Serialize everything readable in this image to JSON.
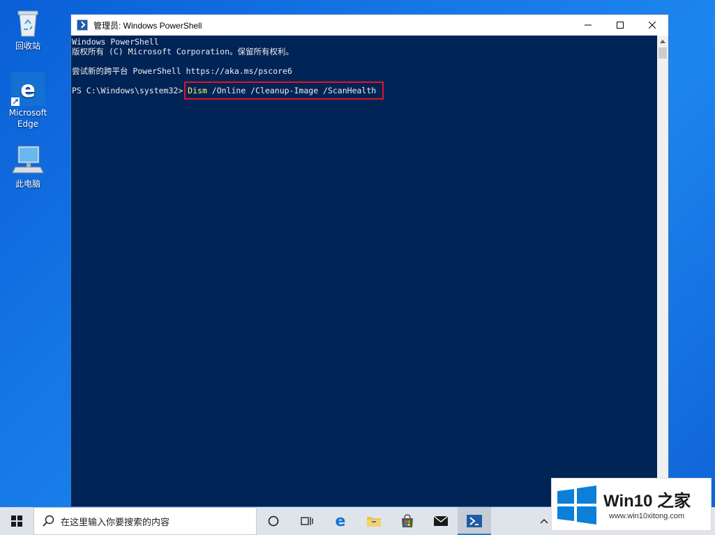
{
  "desktop": {
    "icons": [
      {
        "label": "回收站"
      },
      {
        "label": "Microsoft Edge"
      },
      {
        "label": "此电脑"
      }
    ]
  },
  "window": {
    "title": "管理员: Windows PowerShell"
  },
  "console": {
    "lines": [
      "Windows PowerShell",
      "版权所有 (C) Microsoft Corporation。保留所有权利。",
      "尝试新的跨平台 PowerShell https://aka.ms/pscore6"
    ],
    "prompt": "PS C:\\Windows\\system32> ",
    "command_name": "Dism",
    "command_args": " /Online /Cleanup-Image /ScanHealth"
  },
  "taskbar": {
    "search_placeholder": "在这里输入你要搜索的内容"
  },
  "watermark": {
    "brand": "Win10 之家",
    "url": "www.win10xitong.com"
  },
  "colors": {
    "console_bg": "#012456",
    "command_yellow": "#ffff66",
    "highlight_red": "#e81123"
  }
}
